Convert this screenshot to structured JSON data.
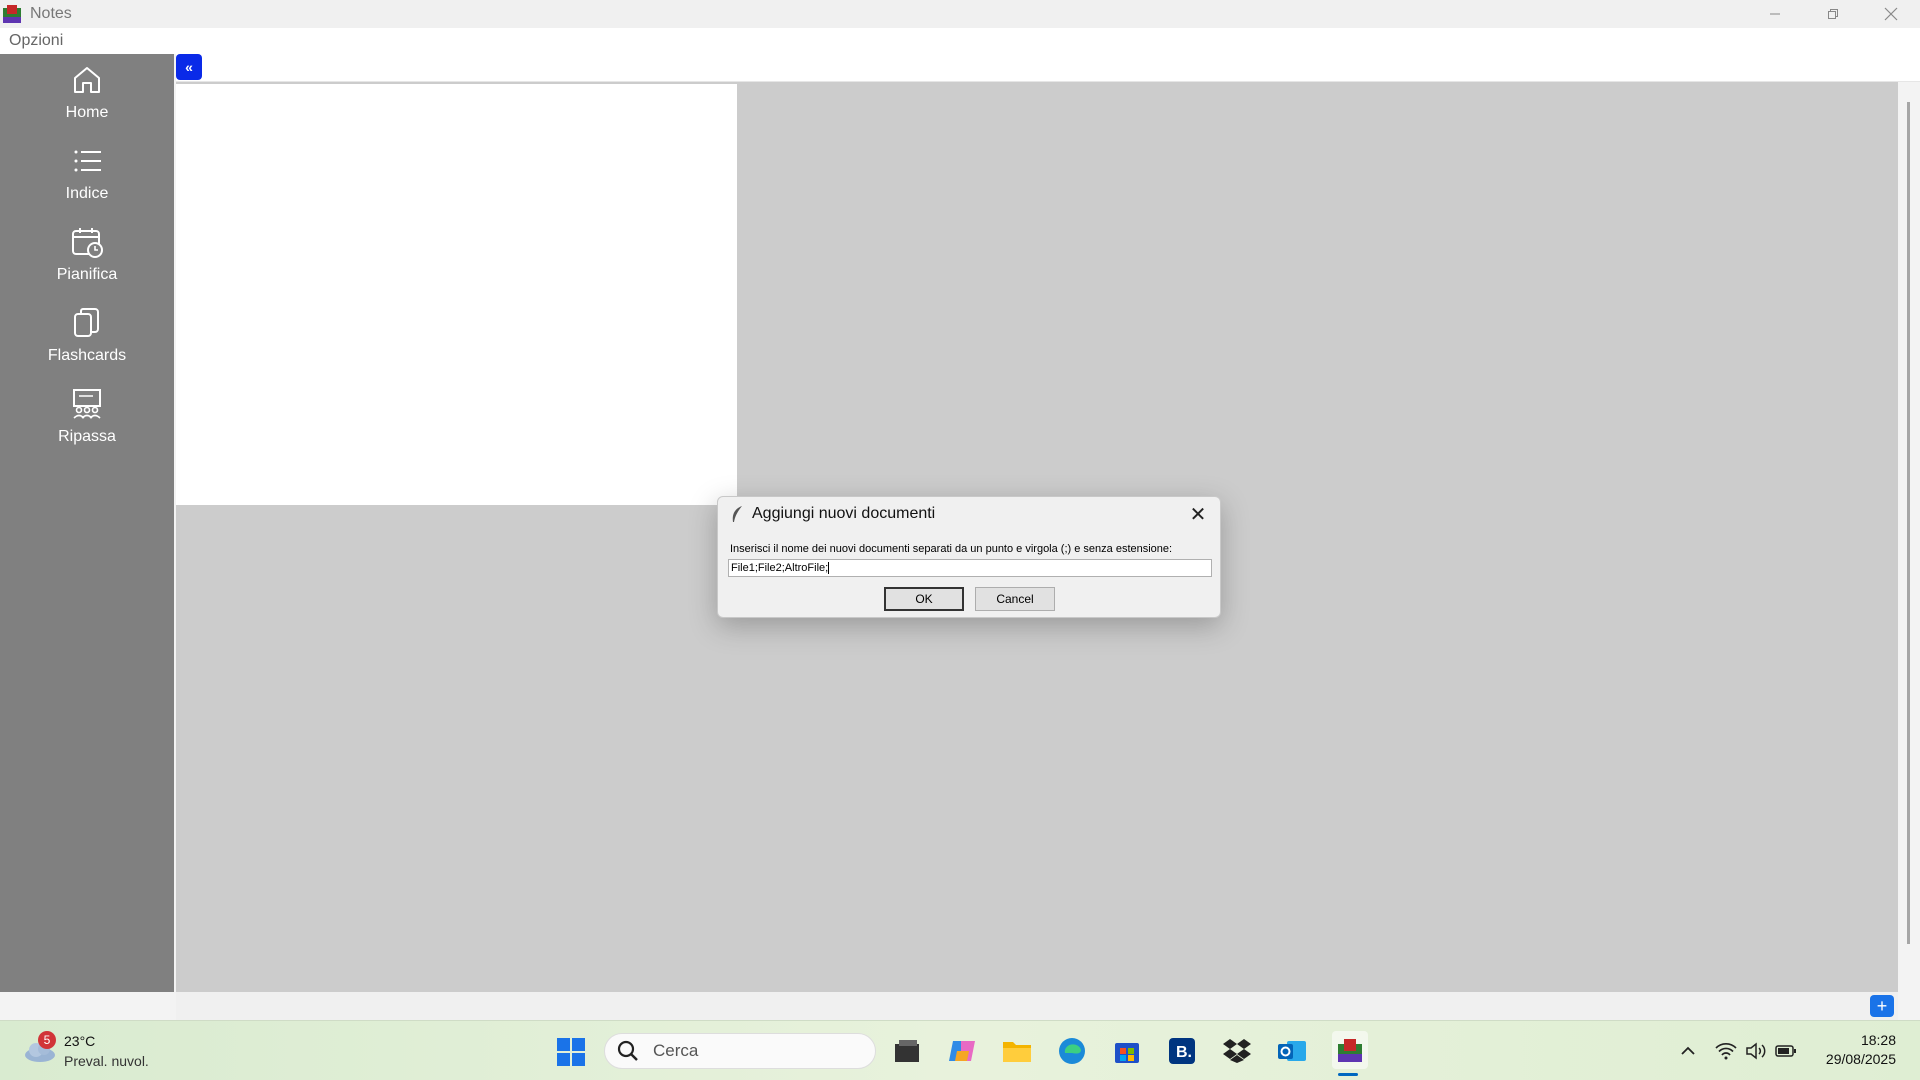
{
  "window": {
    "title": "Notes"
  },
  "menubar": {
    "items": [
      "Opzioni"
    ]
  },
  "sidebar": {
    "items": [
      {
        "label": "Home",
        "icon": "home-icon"
      },
      {
        "label": "Indice",
        "icon": "list-icon"
      },
      {
        "label": "Pianifica",
        "icon": "calendar-clock-icon"
      },
      {
        "label": "Flashcards",
        "icon": "flashcards-icon"
      },
      {
        "label": "Ripassa",
        "icon": "review-icon"
      }
    ]
  },
  "main": {
    "collapse_label": "«",
    "add_label": "+"
  },
  "dialog": {
    "title": "Aggiungi nuovi documenti",
    "prompt": "Inserisci il nome dei nuovi documenti separati da un punto e virgola (;) e senza estensione:",
    "input_value": "File1;File2;AltroFile;",
    "ok_label": "OK",
    "cancel_label": "Cancel",
    "close_glyph": "✕"
  },
  "taskbar": {
    "weather": {
      "badge": "5",
      "temp": "23°C",
      "desc": "Preval. nuvol."
    },
    "search_placeholder": "Cerca",
    "clock": {
      "time": "18:28",
      "date": "29/08/2025"
    },
    "pinned": [
      "windows-start-icon",
      "file-manager-icon",
      "copilot-icon",
      "explorer-folder-icon",
      "edge-icon",
      "store-icon",
      "booking-icon",
      "dropbox-icon",
      "outlook-icon",
      "notes-app-icon"
    ]
  },
  "colors": {
    "sidebar": "#808080",
    "accent": "#0a2ae8",
    "canvas": "#cccccc"
  }
}
